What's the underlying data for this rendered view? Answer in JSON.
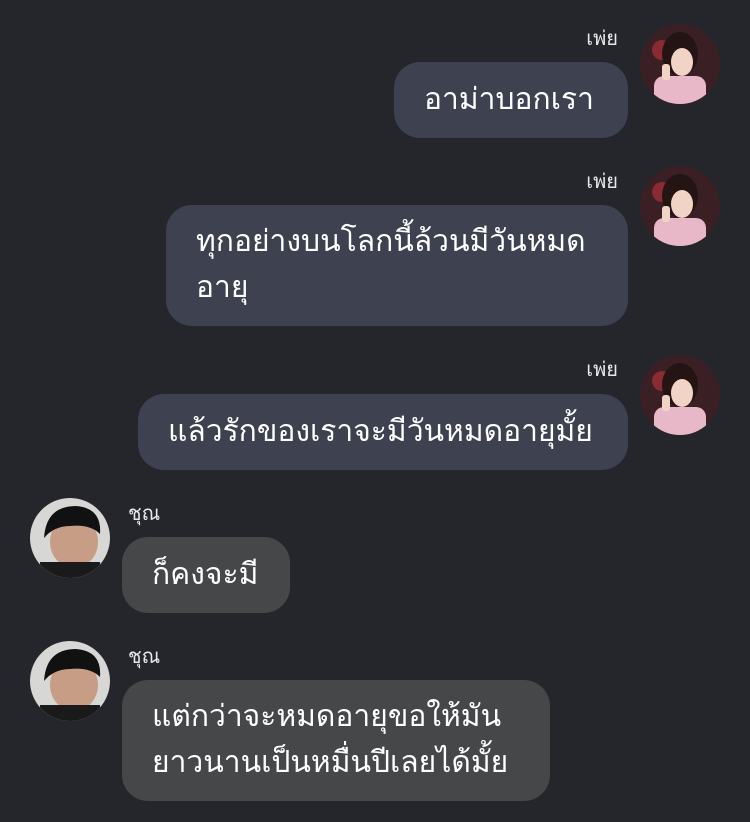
{
  "messages": [
    {
      "sender": "เพ่ย",
      "side": "out",
      "text": "อาม่าบอกเรา"
    },
    {
      "sender": "เพ่ย",
      "side": "out",
      "text": "ทุกอย่างบนโลกนี้ล้วนมีวันหมด\nอายุ"
    },
    {
      "sender": "เพ่ย",
      "side": "out",
      "text": "แล้วรักของเราจะมีวันหมดอายุมั้ย"
    },
    {
      "sender": "ชุณ",
      "side": "in",
      "text": "ก็คงจะมี"
    },
    {
      "sender": "ชุณ",
      "side": "in",
      "text": "แต่กว่าจะหมดอายุขอให้มัน\nยาวนานเป็นหมื่นปีเลยได้มั้ย"
    }
  ],
  "colors": {
    "background": "#25262b",
    "outgoing_bubble": "#3d4150",
    "incoming_bubble": "#464749"
  },
  "avatars": {
    "out": "girl-avatar-icon",
    "in": "boy-avatar-icon"
  }
}
